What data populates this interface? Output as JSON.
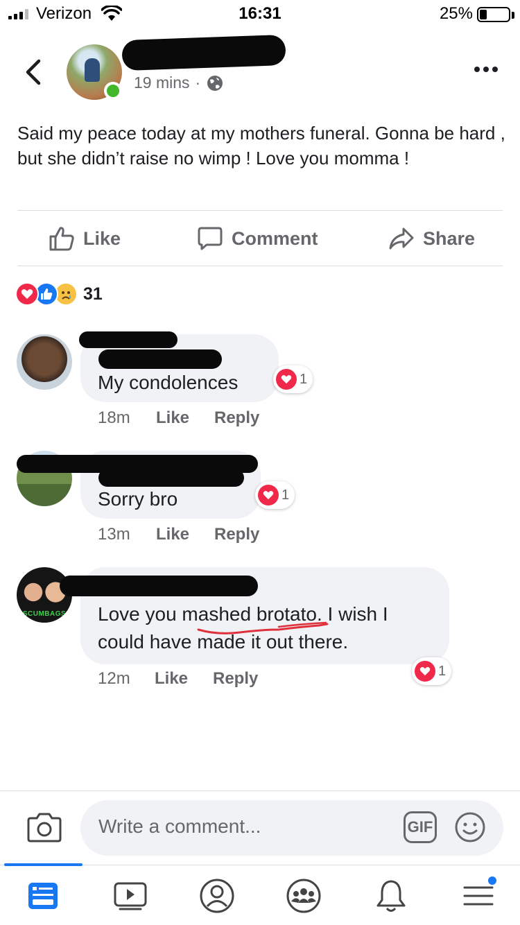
{
  "status_bar": {
    "carrier": "Verizon",
    "time": "16:31",
    "battery": "25%",
    "battery_level": 0.25
  },
  "post": {
    "time": "19 mins",
    "privacy_icon": "globe-icon",
    "text": "Said my peace today at my mothers funeral. Gonna be hard , but she didn’t raise no wimp ! Love you momma !",
    "actions": {
      "like": "Like",
      "comment": "Comment",
      "share": "Share"
    },
    "reaction_icons": [
      "love-reaction-icon",
      "like-reaction-icon",
      "sad-reaction-icon"
    ],
    "reaction_count": "31"
  },
  "comments": [
    {
      "text": "My condolences",
      "time": "18m",
      "like": "Like",
      "reply": "Reply",
      "reactions": "1"
    },
    {
      "text": "Sorry bro",
      "time": "13m",
      "like": "Like",
      "reply": "Reply",
      "reactions": "1"
    },
    {
      "text_line1": "Love you mashed brotato. I wish I",
      "text_line2": "could have made it out there.",
      "time": "12m",
      "like": "Like",
      "reply": "Reply",
      "reactions": "1",
      "avatar_text": "SCUMBAGS"
    }
  ],
  "composer": {
    "placeholder": "Write a comment...",
    "gif_label": "GIF"
  },
  "bottom_nav": [
    "news-feed-icon",
    "watch-icon",
    "profile-icon",
    "groups-icon",
    "notifications-icon",
    "menu-icon"
  ],
  "colors": {
    "accent": "#1877f2",
    "online": "#42b72a",
    "love": "#f02849",
    "bubble": "#f0f2f5",
    "secondary_text": "#65676b"
  }
}
